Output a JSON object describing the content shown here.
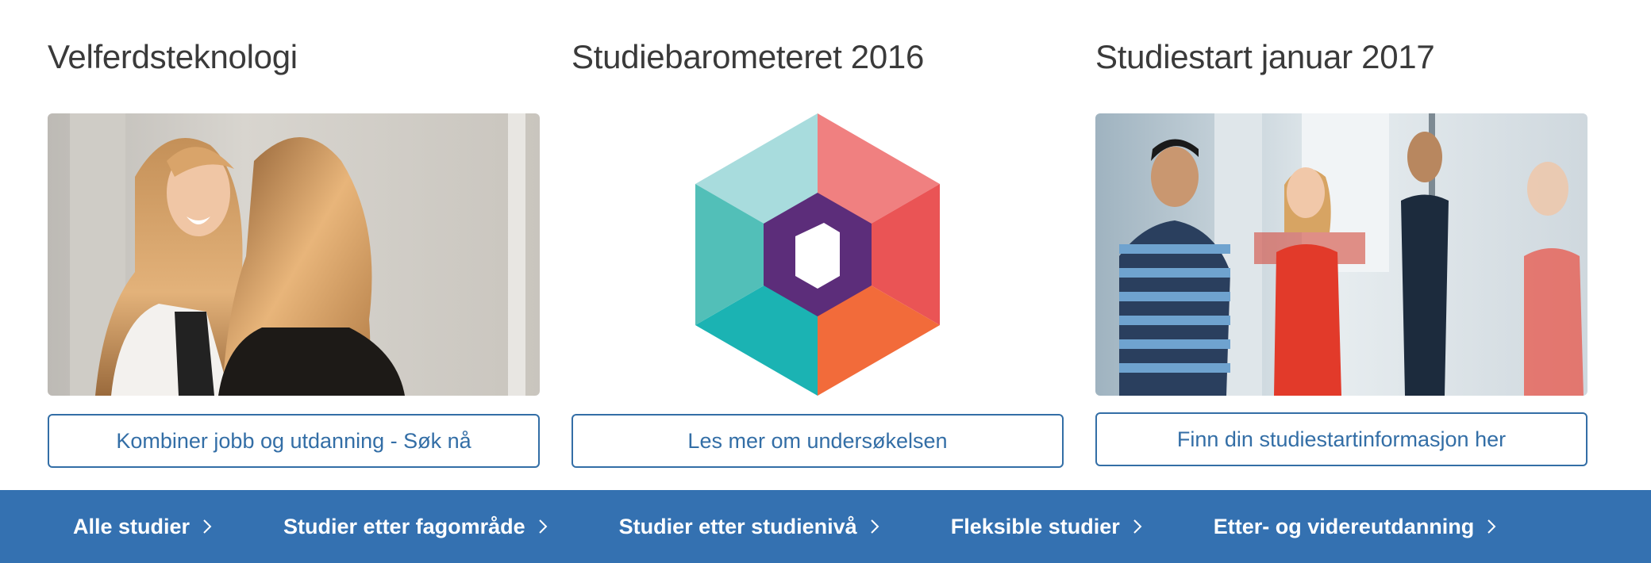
{
  "cards": [
    {
      "title": "Velferdsteknologi",
      "image": "photo-two-women-talking",
      "button_label": "Kombiner jobb og utdanning - Søk nå"
    },
    {
      "title": "Studiebarometeret 2016",
      "image": "studiebarometeret-hexagon-logo",
      "button_label": "Les mer om undersøkelsen"
    },
    {
      "title": "Studiestart januar 2017",
      "image": "photo-students-talking",
      "button_label": "Finn din studiestartinformasjon her"
    }
  ],
  "nav": {
    "items": [
      {
        "label": "Alle studier",
        "icon": "chevron-right-icon"
      },
      {
        "label": "Studier etter fagområde",
        "icon": "chevron-right-icon"
      },
      {
        "label": "Studier etter studienivå",
        "icon": "chevron-right-icon"
      },
      {
        "label": "Fleksible studier",
        "icon": "chevron-right-icon"
      },
      {
        "label": "Etter- og videreutdanning",
        "icon": "chevron-right-icon"
      }
    ]
  },
  "colors": {
    "nav_background": "#3471b1",
    "button_border": "#336ea6",
    "hex_top_left": "#a8dcdd",
    "hex_top_right": "#f08080",
    "hex_right": "#ea5455",
    "hex_bottom_right": "#f26b3a",
    "hex_bottom_left": "#1bb3b3",
    "hex_left": "#52bfb8",
    "hex_center": "#5c2d7a"
  }
}
